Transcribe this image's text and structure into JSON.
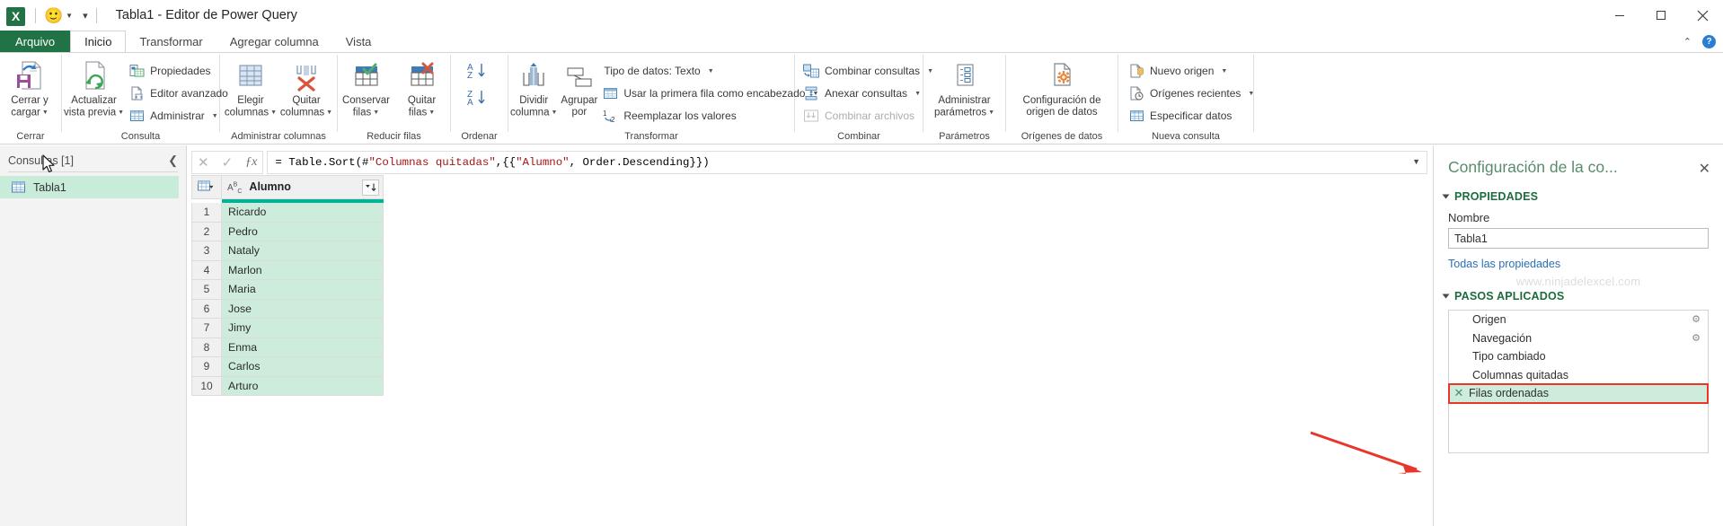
{
  "titlebar": {
    "app_icon": "excel-icon",
    "logo_letter": "X",
    "quick_access_smiley": "🙂",
    "title": "Tabla1 - Editor de Power Query",
    "minimize": "minimize-icon",
    "restore": "restore-icon",
    "close": "close-icon"
  },
  "tabs": [
    {
      "label": "Arquivo",
      "state": "file"
    },
    {
      "label": "Inicio",
      "state": "active"
    },
    {
      "label": "Transformar",
      "state": "normal"
    },
    {
      "label": "Agregar columna",
      "state": "normal"
    },
    {
      "label": "Vista",
      "state": "normal"
    }
  ],
  "tabstrip_right": {
    "collapse": "chevron-up-icon",
    "help": "?"
  },
  "ribbon": {
    "groups": [
      {
        "label": "Cerrar",
        "big_buttons": [
          {
            "label_line1": "Cerrar y",
            "label_line2": "cargar",
            "has_caret": true,
            "icon": "close-and-load-icon"
          }
        ],
        "small_buttons": []
      },
      {
        "label": "Consulta",
        "big_buttons": [
          {
            "label_line1": "Actualizar",
            "label_line2": "vista previa",
            "has_caret": true,
            "icon": "refresh-preview-icon"
          }
        ],
        "small_buttons": [
          {
            "label": "Propiedades",
            "icon": "properties-icon",
            "has_caret": false,
            "disabled": false
          },
          {
            "label": "Editor avanzado",
            "icon": "advanced-editor-icon",
            "has_caret": false,
            "disabled": false
          },
          {
            "label": "Administrar",
            "icon": "manage-icon",
            "has_caret": true,
            "disabled": false
          }
        ]
      },
      {
        "label": "Administrar columnas",
        "big_buttons": [
          {
            "label_line1": "Elegir",
            "label_line2": "columnas",
            "has_caret": true,
            "icon": "choose-columns-icon"
          },
          {
            "label_line1": "Quitar",
            "label_line2": "columnas",
            "has_caret": true,
            "icon": "remove-columns-icon"
          }
        ],
        "small_buttons": []
      },
      {
        "label": "Reducir filas",
        "big_buttons": [
          {
            "label_line1": "Conservar",
            "label_line2": "filas",
            "has_caret": true,
            "icon": "keep-rows-icon"
          },
          {
            "label_line1": "Quitar",
            "label_line2": "filas",
            "has_caret": true,
            "icon": "remove-rows-icon"
          }
        ],
        "small_buttons": []
      },
      {
        "label": "Ordenar",
        "big_buttons": [
          {
            "label_line1": "",
            "label_line2": "",
            "has_caret": false,
            "icon": "sort-az-za-icon"
          }
        ],
        "small_buttons": []
      },
      {
        "label": "Transformar",
        "big_buttons": [
          {
            "label_line1": "Dividir",
            "label_line2": "columna",
            "has_caret": true,
            "icon": "split-column-icon"
          },
          {
            "label_line1": "Agrupar",
            "label_line2": "por",
            "has_caret": false,
            "icon": "group-by-icon"
          }
        ],
        "small_buttons": [
          {
            "label": "Tipo de datos: Texto",
            "icon": "data-type-icon",
            "has_caret": true,
            "disabled": false
          },
          {
            "label": "Usar la primera fila como encabezado",
            "icon": "use-first-row-icon",
            "has_caret": true,
            "disabled": false
          },
          {
            "label": "Reemplazar los valores",
            "icon": "replace-values-icon",
            "has_caret": false,
            "disabled": false
          }
        ]
      },
      {
        "label": "Combinar",
        "big_buttons": [],
        "small_buttons": [
          {
            "label": "Combinar consultas",
            "icon": "merge-queries-icon",
            "has_caret": true,
            "disabled": false
          },
          {
            "label": "Anexar consultas",
            "icon": "append-queries-icon",
            "has_caret": true,
            "disabled": false
          },
          {
            "label": "Combinar archivos",
            "icon": "combine-files-icon",
            "has_caret": false,
            "disabled": true
          }
        ]
      },
      {
        "label": "Parámetros",
        "big_buttons": [
          {
            "label_line1": "Administrar",
            "label_line2": "parámetros",
            "has_caret": true,
            "icon": "manage-parameters-icon"
          }
        ],
        "small_buttons": []
      },
      {
        "label": "Orígenes de datos",
        "big_buttons": [
          {
            "label_line1": "Configuración de",
            "label_line2": "origen de datos",
            "has_caret": false,
            "icon": "data-source-settings-icon"
          }
        ],
        "small_buttons": []
      },
      {
        "label": "Nueva consulta",
        "big_buttons": [],
        "small_buttons": [
          {
            "label": "Nuevo origen",
            "icon": "new-source-icon",
            "has_caret": true,
            "disabled": false
          },
          {
            "label": "Orígenes recientes",
            "icon": "recent-sources-icon",
            "has_caret": true,
            "disabled": false
          },
          {
            "label": "Especificar datos",
            "icon": "enter-data-icon",
            "has_caret": false,
            "disabled": false
          }
        ]
      }
    ]
  },
  "queries_pane": {
    "title": "Consultas [1]",
    "collapse_icon": "chevron-left-icon",
    "items": [
      {
        "label": "Tabla1",
        "icon": "table-icon",
        "selected": true
      }
    ]
  },
  "formula_bar": {
    "cancel_icon": "cancel-icon",
    "accept_icon": "check-icon",
    "fx_icon": "fx-icon",
    "formula_prefix": "= Table.Sort(#",
    "formula_arg1": "\"Columnas quitadas\"",
    "formula_mid": ",{{",
    "formula_str": "\"Alumno\"",
    "formula_suffix": ", Order.Descending}})",
    "expand_icon": "chevron-down-icon"
  },
  "grid": {
    "corner_icon": "select-all-icon",
    "column_type_icon": "ABC",
    "column_header": "Alumno",
    "sort_indicator": "sort-descending-icon",
    "rows": [
      {
        "n": "1",
        "alumno": "Ricardo"
      },
      {
        "n": "2",
        "alumno": "Pedro"
      },
      {
        "n": "3",
        "alumno": "Nataly"
      },
      {
        "n": "4",
        "alumno": "Marlon"
      },
      {
        "n": "5",
        "alumno": "Maria"
      },
      {
        "n": "6",
        "alumno": "Jose"
      },
      {
        "n": "7",
        "alumno": "Jimy"
      },
      {
        "n": "8",
        "alumno": "Enma"
      },
      {
        "n": "9",
        "alumno": "Carlos"
      },
      {
        "n": "10",
        "alumno": "Arturo"
      }
    ]
  },
  "settings_pane": {
    "title": "Configuración de la co...",
    "close_icon": "close-icon",
    "properties_section": {
      "heading": "PROPIEDADES",
      "name_label": "Nombre",
      "name_value": "Tabla1",
      "all_properties_link": "Todas las propiedades"
    },
    "watermark": "www.ninjadelexcel.com",
    "applied_steps_section": {
      "heading": "PASOS APLICADOS",
      "steps": [
        {
          "label": "Origen",
          "gear": true,
          "active": false
        },
        {
          "label": "Navegación",
          "gear": true,
          "active": false
        },
        {
          "label": "Tipo cambiado",
          "gear": false,
          "active": false
        },
        {
          "label": "Columnas quitadas",
          "gear": false,
          "active": false
        },
        {
          "label": "Filas ordenadas",
          "gear": false,
          "active": true
        }
      ]
    }
  },
  "annotation": {
    "arrow_color": "#e8362a",
    "highlight_color": "#e8362a"
  },
  "colors": {
    "excel_green": "#217346",
    "selection_green": "#cdecdb",
    "accent_teal": "#00b396",
    "link_blue": "#2a6fb5",
    "section_heading": "#1d6b3f"
  }
}
